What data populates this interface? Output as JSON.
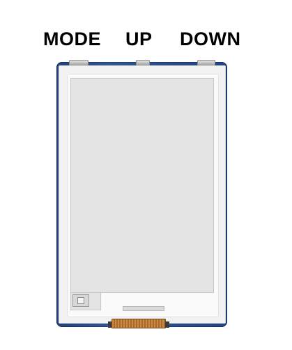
{
  "labels": {
    "mode": "MODE",
    "up": "UP",
    "down": "DOWN"
  },
  "colors": {
    "board": "#274d8f",
    "display": "#e4e4e4",
    "connector": "#c98a45"
  }
}
